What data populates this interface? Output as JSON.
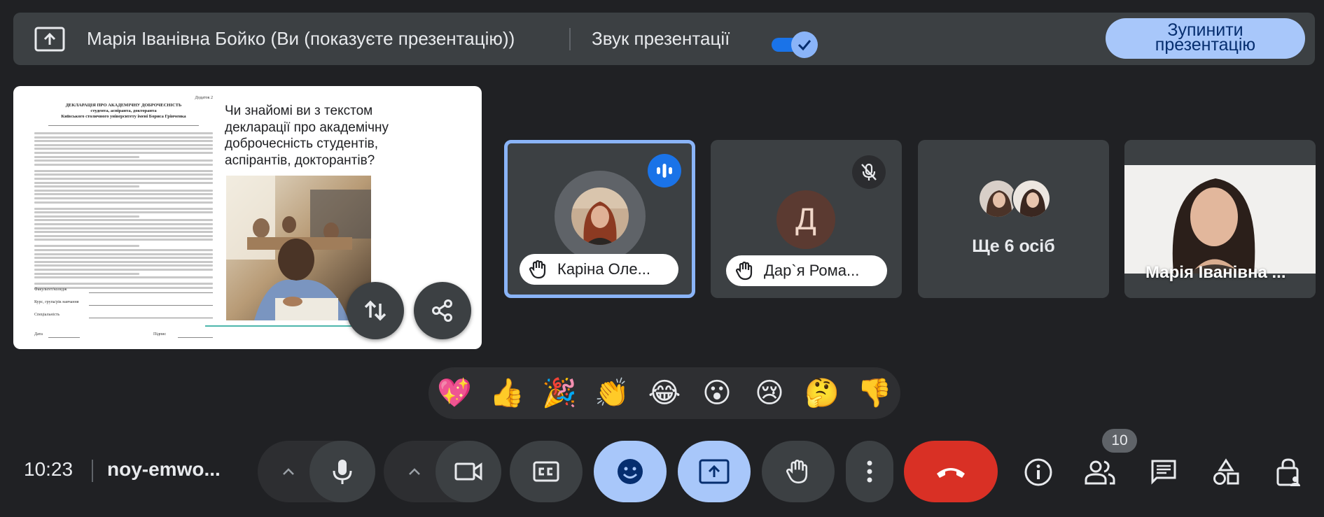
{
  "topbar": {
    "presenter": "Марія Іванівна Бойко (Ви (показуєте презентацію))",
    "audio_label": "Звук презентації",
    "audio_on": true,
    "stop_label": "Зупинити\nпрезентацію"
  },
  "slide": {
    "question": "Чи знайомі ви з текстом декларації про академічну доброчесність студентів, аспірантів, докторантів?",
    "doc": {
      "corner": "Додаток 2",
      "title": "ДЕКЛАРАЦІЯ ПРО АКАДЕМІЧНУ ДОБРОЧЕСНІСТЬ\nстудента, аспіранта, докторанта\nКиївського столичного університету імені Бориса Грінченка",
      "faculty": "Факультет/коледж",
      "course": "Курс, група/рік навчання",
      "specialty": "Спеціальність",
      "date": "Дата",
      "signature": "Підпис"
    }
  },
  "tiles": [
    {
      "name": "Каріна Оле...",
      "state": "speaking",
      "hand_raised": true
    },
    {
      "name": "Дар`я Рома...",
      "initial": "Д",
      "state": "muted",
      "hand_raised": true
    },
    {
      "label": "Ще 6 осіб"
    },
    {
      "name": "Марія Іванівна ..."
    }
  ],
  "reactions": [
    "💖",
    "👍",
    "🎉",
    "👏",
    "😂",
    "😮",
    "😢",
    "🤔",
    "👎"
  ],
  "bottom": {
    "time": "10:23",
    "meeting_code": "noy-emwo...",
    "participants_count": "10"
  },
  "colors": {
    "accent_blue": "#a8c7fa",
    "active_border": "#8ab4f8",
    "end_call_red": "#d93025",
    "speaking_blue": "#1a73e8"
  }
}
